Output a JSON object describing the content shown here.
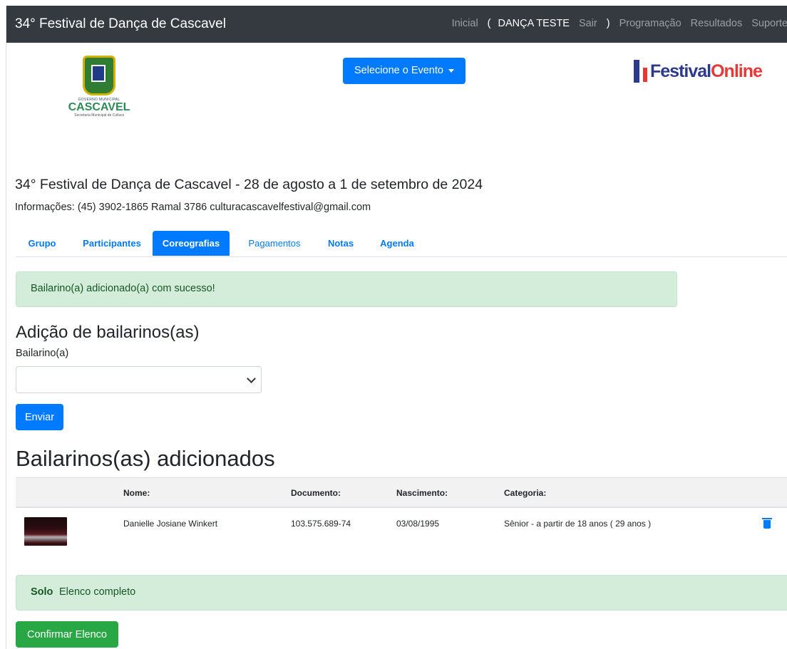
{
  "navbar": {
    "brand": "34° Festival de Dança de Cascavel",
    "inicial": "Inicial",
    "open_paren": "(",
    "user": "DANÇA TESTE",
    "sair": "Sair",
    "close_paren": ")",
    "programacao": "Programação",
    "resultados": "Resultados",
    "suporte": "Suporte"
  },
  "header": {
    "gov_small": "GOVERNO MUNICIPAL",
    "city": "CASCAVEL",
    "secretaria": "Secretaria Municipal de Cultura",
    "event_select": "Selecione o Evento",
    "fo_logo_part1": "Festival",
    "fo_logo_part2": "Online"
  },
  "event": {
    "title": "34° Festival de Dança de Cascavel - 28 de agosto a 1 de setembro de 2024",
    "info": "Informações: (45) 3902-1865 Ramal 3786 culturacascavelfestival@gmail.com"
  },
  "tabs": [
    "Grupo",
    "Participantes",
    "Coreografias",
    "Pagamentos",
    "Notas",
    "Agenda"
  ],
  "alert_success": "Bailarino(a) adicionado(a) com sucesso!",
  "add_section": {
    "heading": "Adição de bailarinos(as)",
    "label": "Bailarino(a)",
    "selected_value": "",
    "submit": "Enviar"
  },
  "added_section": {
    "heading": "Bailarinos(as) adicionados",
    "columns": [
      "Nome:",
      "Documento:",
      "Nascimento:",
      "Categoria:"
    ],
    "rows": [
      {
        "name": "Danielle Josiane Winkert",
        "document": "103.575.689-74",
        "birth": "03/08/1995",
        "category": "Sênior - a partir de 18 anos ( 29 anos )"
      }
    ]
  },
  "status": {
    "bold": "Solo",
    "text": "Elenco completo"
  },
  "confirm_button": "Confirmar Elenco",
  "colors": {
    "primary": "#007bff",
    "success": "#28a745",
    "navbar": "#343a40",
    "alert_bg": "#d4edda",
    "alert_text": "#155724"
  }
}
